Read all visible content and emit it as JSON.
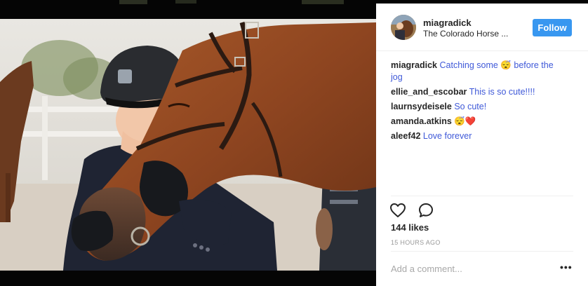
{
  "post": {
    "username": "miagradick",
    "location": "The Colorado Horse ...",
    "follow_label": "Follow",
    "likes": "144 likes",
    "time_ago": "15 HOURS AGO",
    "comment_placeholder": "Add a comment...",
    "more_label": "•••"
  },
  "comments": [
    {
      "user": "miagradick",
      "text": "Catching some 😴 before the jog"
    },
    {
      "user": "ellie_and_escobar",
      "text": "This is so cute!!!!"
    },
    {
      "user": "laurnsydeisele",
      "text": "So cute!"
    },
    {
      "user": "amanda.atkins",
      "text": "😴❤️"
    },
    {
      "user": "aleef42",
      "text": "Love forever"
    }
  ],
  "colors": {
    "follow": "#3897f0",
    "comment_text": "#3f59d8",
    "horse_coat": "#8b4a22",
    "helmet": "#2a2c30"
  },
  "icons": [
    "heart-icon",
    "comment-icon",
    "more-options-icon"
  ]
}
